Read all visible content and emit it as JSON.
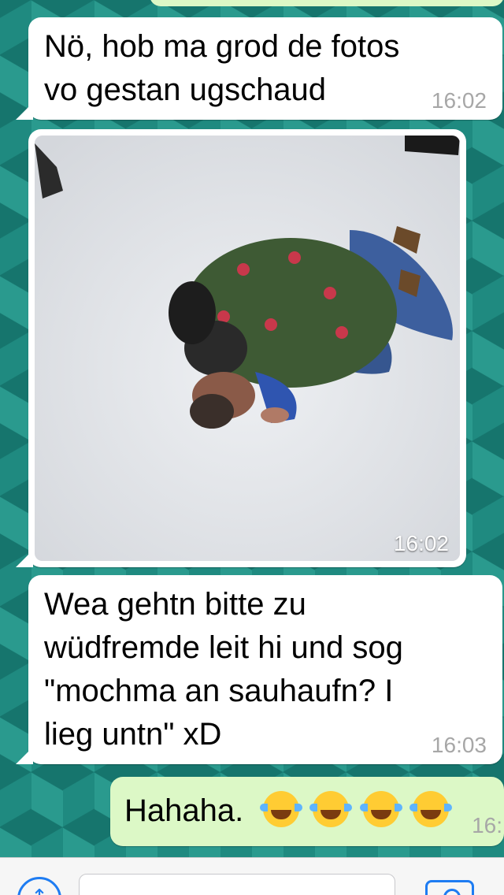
{
  "messages": [
    {
      "direction": "incoming",
      "type": "text",
      "text": "Nö, hob ma grod de fotos\nvo gestan ugschaud",
      "time": "16:02"
    },
    {
      "direction": "incoming",
      "type": "image",
      "image_description_icon": "photo-icon",
      "time": "16:02"
    },
    {
      "direction": "incoming",
      "type": "text",
      "text": "Wea gehtn bitte zu\nwüdfremde leit hi und sog\n\"mochma an sauhaufn? I\nlieg untn\" xD",
      "time": "16:03"
    },
    {
      "direction": "outgoing",
      "type": "text",
      "text": "Hahaha.",
      "emoji": [
        "tears-of-joy-emoji",
        "tears-of-joy-emoji",
        "tears-of-joy-emoji",
        "tears-of-joy-emoji"
      ],
      "time": "16:"
    }
  ],
  "composer": {
    "attach_icon": "share-upload-icon",
    "input_value": "",
    "camera_icon": "camera-icon"
  },
  "colors": {
    "incoming_bubble": "#ffffff",
    "outgoing_bubble": "#dcf8c6",
    "background": "#1f8a80",
    "accent": "#1e7cf2"
  }
}
